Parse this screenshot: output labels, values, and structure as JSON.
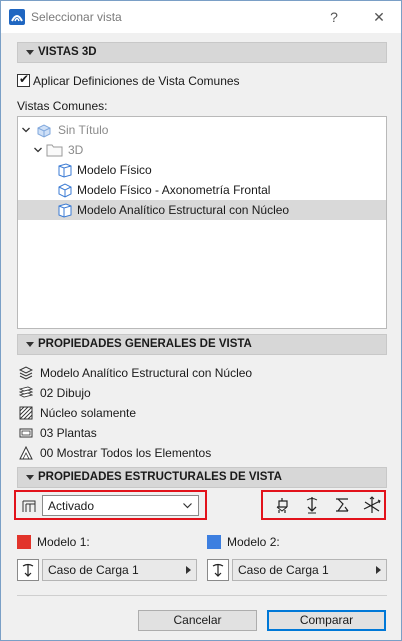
{
  "window": {
    "title": "Seleccionar vista",
    "help_glyph": "?",
    "close_glyph": "✕"
  },
  "section_3d": {
    "header": "VISTAS 3D",
    "apply_common_checkbox": {
      "label": "Aplicar Definiciones de Vista Comunes",
      "checked": true
    },
    "common_views_label": "Vistas Comunes:",
    "tree": [
      {
        "label": "Sin Título",
        "icon": "views-folder-icon",
        "dimmed": true,
        "selected": false
      },
      {
        "label": "3D",
        "icon": "folder-icon",
        "dimmed": true,
        "selected": false
      },
      {
        "label": "Modelo Físico",
        "icon": "3d-view-icon",
        "dimmed": false,
        "selected": false
      },
      {
        "label": "Modelo Físico - Axonometría Frontal",
        "icon": "3d-axon-icon",
        "dimmed": false,
        "selected": false
      },
      {
        "label": "Modelo Analítico Estructural con Núcleo",
        "icon": "3d-view-icon",
        "dimmed": false,
        "selected": true
      }
    ]
  },
  "section_general": {
    "header": "PROPIEDADES GENERALES DE VISTA",
    "items": [
      {
        "label": "Modelo Analítico Estructural con Núcleo",
        "icon": "model-view-options-icon"
      },
      {
        "label": "02 Dibujo",
        "icon": "layers-icon"
      },
      {
        "label": "Núcleo solamente",
        "icon": "hatch-icon"
      },
      {
        "label": "03 Plantas",
        "icon": "pen-set-icon"
      },
      {
        "label": "00 Mostrar Todos los Elementos",
        "icon": "renovation-filter-icon"
      }
    ]
  },
  "section_structural": {
    "header": "PROPIEDADES ESTRUCTURALES DE VISTA",
    "analytical_dropdown": {
      "value": "Activado"
    },
    "display_buttons": [
      "support-icon",
      "load-icon",
      "member-icon",
      "axes-icon"
    ],
    "model1": {
      "label": "Modelo 1:",
      "color": "#e2342b",
      "load_case": "Caso de Carga 1"
    },
    "model2": {
      "label": "Modelo 2:",
      "color": "#3d7fe0",
      "load_case": "Caso de Carga 1"
    }
  },
  "footer": {
    "cancel_label": "Cancelar",
    "compare_label": "Comparar"
  }
}
